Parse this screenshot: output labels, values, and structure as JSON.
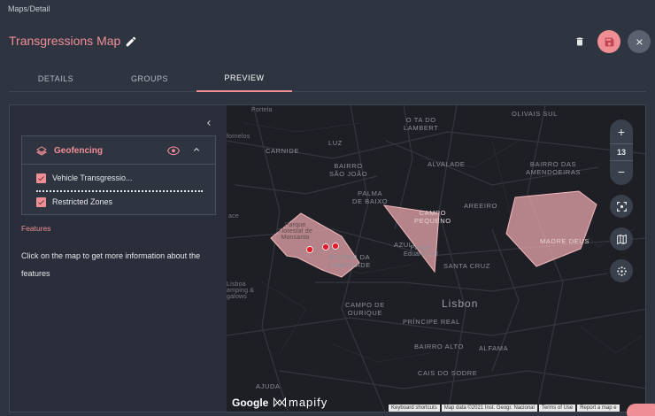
{
  "breadcrumb": {
    "root": "Maps",
    "sep": "/",
    "current": "Detail"
  },
  "page_title": "Transgressions Map",
  "tabs": [
    "DETAILS",
    "GROUPS",
    "PREVIEW"
  ],
  "active_tab": "PREVIEW",
  "accent_color": "#ef8f95",
  "layer_card": {
    "title": "Geofencing",
    "items": [
      {
        "label": "Vehicle Transgressio...",
        "checked": true
      },
      {
        "label": "Restricted Zones",
        "checked": true
      }
    ]
  },
  "features": {
    "label": "Features",
    "info": "Click on the map to get more information about the features"
  },
  "map": {
    "zoom_level": "13",
    "zoom_in": "+",
    "zoom_out": "−",
    "labels": {
      "portela": "Portela",
      "olivais": "OLIVAIS SUL",
      "lambert": "O TA DO\nLAMBERT",
      "fornelos": "fornelos",
      "luz": "LUZ",
      "carnide": "CARNIDE",
      "alvalade": "ALVALADE",
      "amendoeiras": "BAIRRO DAS\nAMENDOEIRAS",
      "saojoao": "BAIRRO\nSÃO JOÃO",
      "palma": "PALMA\nDE BAIXO",
      "campo_pequeno": "CAMPO\nPEQUENO",
      "areeiro": "AREEIRO",
      "madre_deus": "MADRE DEUS",
      "parque_florestal": "Parque\nFlorestal de\nMonsanto",
      "bairro_liberdade": "BAIRRO DA\nLIBERDADE",
      "azul": "AZUL",
      "parque_eduardo": "Parque\nEduardo VII",
      "santa_cruz": "SANTA CRUZ",
      "lisboa_camping": "Lisboa\namping &\ngalows",
      "campo_ourique": "CAMPO DE\nOURIQUE",
      "lisbon": "Lisbon",
      "principe_real": "PRÍNCIPE REAL",
      "bairro_alto": "BAIRRO ALTO",
      "alfama": "ALFAMA",
      "cais_sodre": "CAIS DO SODRE",
      "ajuda": "AJUDA",
      "ace": "ace"
    },
    "brand_google": "Google",
    "brand_mapify": "mapify",
    "attribution": [
      "Keyboard shortcuts",
      "Map data ©2021 Inst. Geogr. Nacional",
      "Terms of Use",
      "Report a map e"
    ]
  }
}
